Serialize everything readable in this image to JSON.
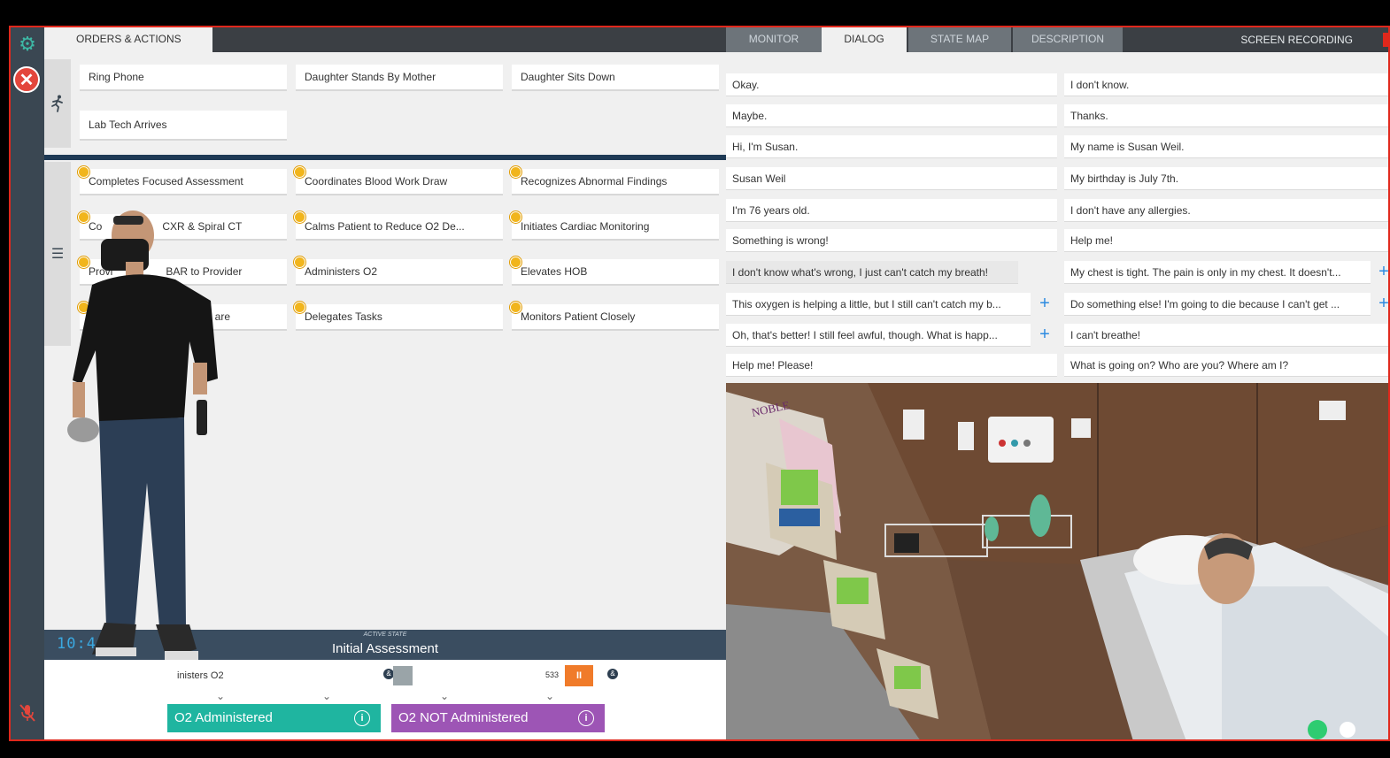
{
  "left_panel": {
    "tab_label": "ORDERS & ACTIONS",
    "events": [
      "Ring Phone",
      "Daughter Stands By Mother",
      "Daughter Sits Down",
      "Lab Tech Arrives"
    ],
    "actions": [
      "Completes Focused Assessment",
      "Coordinates Blood Work Draw",
      "Recognizes Abnormal Findings",
      "Co",
      "Calms Patient to Reduce O2 De...",
      "Initiates Cardiac Monitoring",
      "Provi",
      "Administers O2",
      "Elevates HOB",
      "C",
      "Delegates Tasks",
      "Monitors Patient Closely"
    ],
    "action_fragments": [
      "CXR & Spiral CT",
      "BAR to Provider",
      "are"
    ]
  },
  "state": {
    "clock": "10:46:07",
    "label": "ACTIVE STATE",
    "title": "Initial Assessment"
  },
  "timeline": {
    "current_item": "inisters O2",
    "marker_a": "&",
    "number": "533",
    "pause_label": "II",
    "branches": [
      {
        "label": "O2 Administered",
        "color": "#1fb5a0"
      },
      {
        "label": "O2 NOT Administered",
        "color": "#9d55b5"
      }
    ]
  },
  "right_panel": {
    "tabs": [
      "MONITOR",
      "DIALOG",
      "STATE MAP",
      "DESCRIPTION"
    ],
    "active_tab": "DIALOG",
    "screen_recording": "SCREEN RECORDING",
    "dialog_left": [
      "Okay.",
      "Maybe.",
      "Hi, I'm Susan.",
      "Susan Weil",
      "I'm 76 years old.",
      "Something is wrong!",
      "I don't know what's wrong, I just can't catch my breath!",
      "This oxygen is helping a little, but I still can't catch my b...",
      "Oh, that's better! I still feel awful, though. What is happ...",
      "Help me! Please!"
    ],
    "dialog_right": [
      "I don't know.",
      "Thanks.",
      "My name is Susan Weil.",
      "My birthday is July 7th.",
      "I don't have any allergies.",
      "Help me!",
      "My chest is tight. The pain is only in my chest. It doesn't...",
      "Do something else! I'm going to die because I can't get ...",
      "I can't breathe!",
      "What is going on? Who are you? Where am I?"
    ]
  },
  "scene": {
    "glove_box_text": "NOBLE"
  },
  "icons": {
    "settings": "gear-icon",
    "close": "close-icon",
    "mute": "mic-off-icon",
    "events": "running-person-icon",
    "actions": "list-icon",
    "info": "info-icon",
    "add": "plus-icon"
  },
  "colors": {
    "accent": "#3db8a5",
    "frame_border": "#e0281c",
    "state_bar": "#3a4d60"
  }
}
